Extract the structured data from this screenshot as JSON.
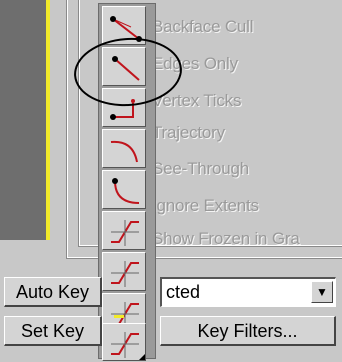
{
  "display_options": [
    {
      "label": "Backface Cull"
    },
    {
      "label": "Edges Only"
    },
    {
      "label": "Vertex Ticks"
    },
    {
      "label": "Trajectory"
    },
    {
      "label": "See-Through"
    },
    {
      "label": "Ignore Extents"
    },
    {
      "label": "Show Frozen in Gra"
    }
  ],
  "flyout_icons": [
    "backface-cull-icon",
    "edges-only-icon",
    "vertex-ticks-icon",
    "trajectory-icon",
    "see-through-icon",
    "ignore-extents-icon",
    "key-curve-icon",
    "key-curve-icon",
    "key-curve-icon"
  ],
  "animation_controls": {
    "auto_key_label": "Auto Key",
    "set_key_label": "Set Key",
    "selection_value": "cted",
    "key_filters_label": "Key Filters..."
  },
  "colors": {
    "icon_red": "#c0141c",
    "viewport_border": "#f2ea2a",
    "disabled_text": "#9a9a9a"
  }
}
